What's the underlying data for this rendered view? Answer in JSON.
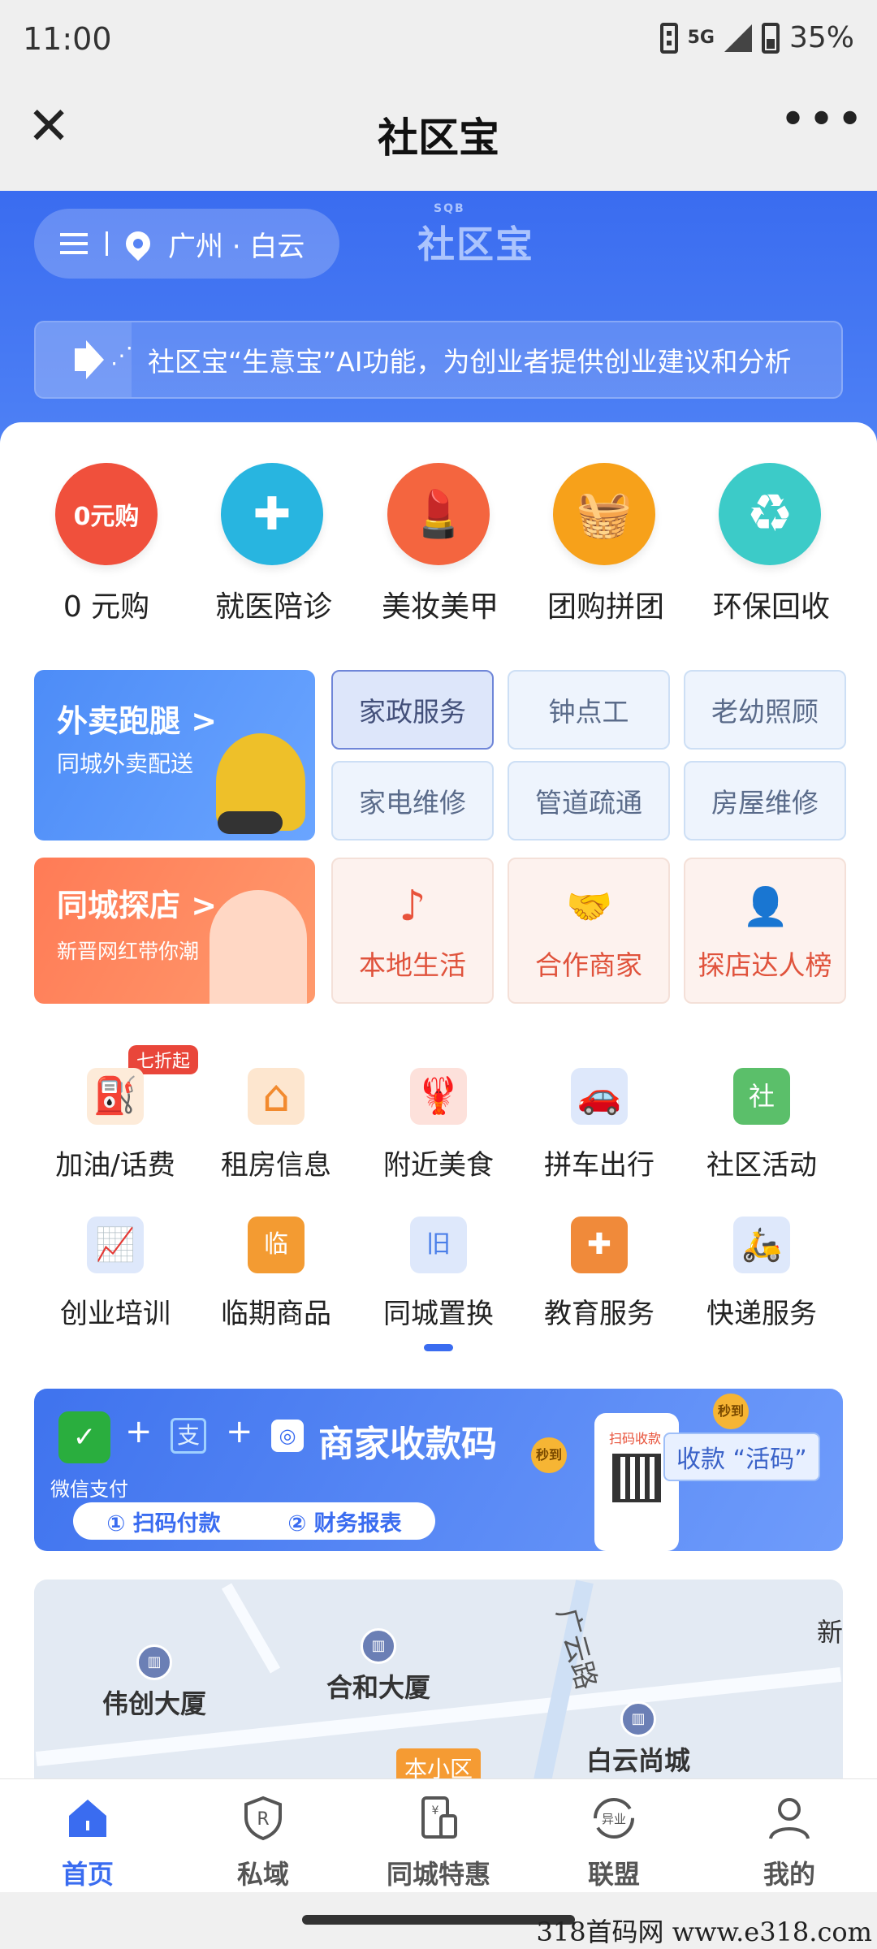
{
  "status_bar": {
    "time": "11:00",
    "network": "5G",
    "battery": "35%"
  },
  "title_bar": {
    "close": "✕",
    "title": "社区宝",
    "more": "•••"
  },
  "header": {
    "location": "广州 · 白云",
    "logo": "社区宝",
    "logo_small": "SQB",
    "notice": "社区宝“生意宝”AI功能，为创业者提供创业建议和分析"
  },
  "top_icons": [
    {
      "label": "0 元购",
      "glyph": "0元购",
      "color": "#f0503c",
      "icon": "zero-yuan-icon"
    },
    {
      "label": "就医陪诊",
      "glyph": "✚",
      "color": "#28b5e0",
      "icon": "doctor-icon"
    },
    {
      "label": "美妆美甲",
      "glyph": "💄",
      "color": "#f4653f",
      "icon": "lipstick-icon"
    },
    {
      "label": "团购拼团",
      "glyph": "🧺",
      "color": "#f7a11a",
      "icon": "basket-icon"
    },
    {
      "label": "环保回收",
      "glyph": "♻",
      "color": "#3ccbc8",
      "icon": "recycle-icon"
    }
  ],
  "services": {
    "takeout": {
      "title": "外卖跑腿 >",
      "subtitle": "同城外卖配送"
    },
    "explore": {
      "title": "同城探店 >",
      "subtitle": "新晋网红带你潮"
    },
    "chips": [
      "家政服务",
      "钟点工",
      "老幼照顾",
      "家电维修",
      "管道疏通",
      "房屋维修"
    ],
    "big_chips": [
      {
        "label": "本地生活",
        "icon": "tiktok-icon",
        "glyph": "♪"
      },
      {
        "label": "合作商家",
        "icon": "handshake-icon",
        "glyph": "🤝"
      },
      {
        "label": "探店达人榜",
        "icon": "influencer-icon",
        "glyph": "👤"
      }
    ]
  },
  "grid": [
    {
      "label": "加油/话费",
      "icon": "fuel-icon",
      "color": "#f59a3a",
      "glyph": "⛽"
    },
    {
      "label": "租房信息",
      "icon": "house-icon",
      "color": "#f28a2e",
      "glyph": "⌂"
    },
    {
      "label": "附近美食",
      "icon": "lobster-icon",
      "color": "#e8533b",
      "glyph": "🦞"
    },
    {
      "label": "拼车出行",
      "icon": "car-icon",
      "color": "#4a7ee8",
      "glyph": "🚗"
    },
    {
      "label": "社区活动",
      "icon": "community-icon",
      "color": "#5bbf6a",
      "glyph": "社"
    },
    {
      "label": "创业培训",
      "icon": "training-icon",
      "color": "#4a7ee8",
      "glyph": "📈"
    },
    {
      "label": "临期商品",
      "icon": "bag-icon",
      "color": "#f39b32",
      "glyph": "临"
    },
    {
      "label": "同城置换",
      "icon": "exchange-icon",
      "color": "#4a7ee8",
      "glyph": "旧"
    },
    {
      "label": "教育服务",
      "icon": "education-icon",
      "color": "#f08a3a",
      "glyph": "✚"
    },
    {
      "label": "快递服务",
      "icon": "courier-icon",
      "color": "#4a7ee8",
      "glyph": "🛵"
    }
  ],
  "badge": "七折起",
  "pay_banner": {
    "title": "商家收款码",
    "wechat_label": "微信支付",
    "step1": "① 扫码付款",
    "step2": "② 财务报表",
    "collect_tag": "收款 “活码”",
    "scan_text": "扫码收款",
    "coin": "秒到"
  },
  "map": {
    "pois": [
      "伟创大厦",
      "合和大厦",
      "白云尚城"
    ],
    "street": "广云路",
    "edge": "新",
    "here": "本小区"
  },
  "nav": [
    {
      "label": "首页",
      "icon": "home-icon",
      "active": true
    },
    {
      "label": "私域",
      "icon": "shield-icon",
      "active": false
    },
    {
      "label": "同城特惠",
      "icon": "discount-icon",
      "active": false
    },
    {
      "label": "联盟",
      "icon": "alliance-icon",
      "active": false
    },
    {
      "label": "我的",
      "icon": "profile-icon",
      "active": false
    }
  ],
  "watermark": "318首码网  www.e318.com"
}
